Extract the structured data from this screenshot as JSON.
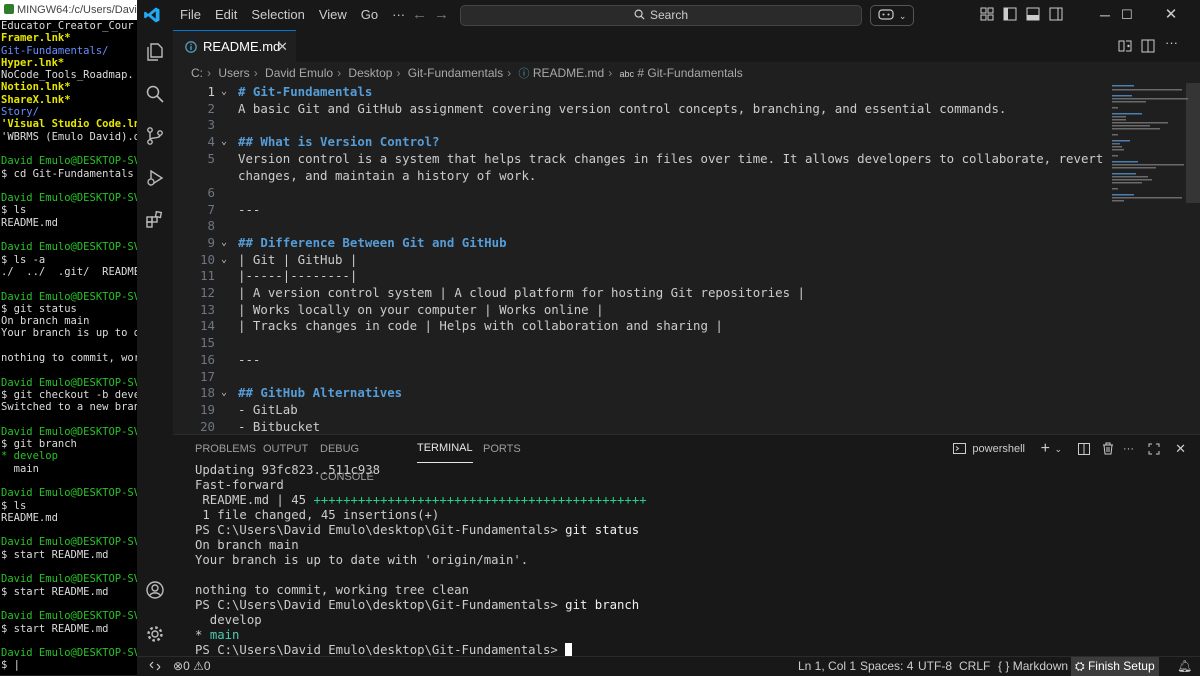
{
  "mingw": {
    "title": "MINGW64:/c/Users/David",
    "lines": [
      {
        "t": "Educator_Creator_Cour",
        "c": "w"
      },
      {
        "t": "Framer.lnk*",
        "c": "c"
      },
      {
        "t": "Git-Fundamentals/",
        "c": "b"
      },
      {
        "t": "Hyper.lnk*",
        "c": "c"
      },
      {
        "t": "NoCode_Tools_Roadmap.",
        "c": "w"
      },
      {
        "t": "Notion.lnk*",
        "c": "c"
      },
      {
        "t": "ShareX.lnk*",
        "c": "c"
      },
      {
        "t": "Story/",
        "c": "b"
      },
      {
        "t": "'Visual Studio Code.ln",
        "c": "c"
      },
      {
        "t": "'WBRMS (Emulo David).d",
        "c": "w"
      },
      {
        "t": "",
        "c": "w"
      },
      {
        "t": "David Emulo@DESKTOP-SV",
        "c": "g"
      },
      {
        "t": "$ cd Git-Fundamentals",
        "c": "w"
      },
      {
        "t": "",
        "c": "w"
      },
      {
        "t": "David Emulo@DESKTOP-SV",
        "c": "g"
      },
      {
        "t": "$ ls",
        "c": "w"
      },
      {
        "t": "README.md",
        "c": "w"
      },
      {
        "t": "",
        "c": "w"
      },
      {
        "t": "David Emulo@DESKTOP-SV",
        "c": "g"
      },
      {
        "t": "$ ls -a",
        "c": "w"
      },
      {
        "t": "./  ../  .git/  README",
        "c": "w"
      },
      {
        "t": "",
        "c": "w"
      },
      {
        "t": "David Emulo@DESKTOP-SV",
        "c": "g"
      },
      {
        "t": "$ git status",
        "c": "w"
      },
      {
        "t": "On branch main",
        "c": "w"
      },
      {
        "t": "Your branch is up to d",
        "c": "w"
      },
      {
        "t": "",
        "c": "w"
      },
      {
        "t": "nothing to commit, wor",
        "c": "w"
      },
      {
        "t": "",
        "c": "w"
      },
      {
        "t": "David Emulo@DESKTOP-SV",
        "c": "g"
      },
      {
        "t": "$ git checkout -b deve",
        "c": "w"
      },
      {
        "t": "Switched to a new bran",
        "c": "w"
      },
      {
        "t": "",
        "c": "w"
      },
      {
        "t": "David Emulo@DESKTOP-SV",
        "c": "g"
      },
      {
        "t": "$ git branch",
        "c": "w"
      },
      {
        "t": "* develop",
        "c": "g"
      },
      {
        "t": "  main",
        "c": "w"
      },
      {
        "t": "",
        "c": "w"
      },
      {
        "t": "David Emulo@DESKTOP-SV",
        "c": "g"
      },
      {
        "t": "$ ls",
        "c": "w"
      },
      {
        "t": "README.md",
        "c": "w"
      },
      {
        "t": "",
        "c": "w"
      },
      {
        "t": "David Emulo@DESKTOP-SV",
        "c": "g"
      },
      {
        "t": "$ start README.md",
        "c": "w"
      },
      {
        "t": "",
        "c": "w"
      },
      {
        "t": "David Emulo@DESKTOP-SV",
        "c": "g"
      },
      {
        "t": "$ start README.md",
        "c": "w"
      },
      {
        "t": "",
        "c": "w"
      },
      {
        "t": "David Emulo@DESKTOP-SV",
        "c": "g"
      },
      {
        "t": "$ start README.md",
        "c": "w"
      },
      {
        "t": "",
        "c": "w"
      },
      {
        "t": "David Emulo@DESKTOP-SV",
        "c": "g"
      },
      {
        "t": "$ |",
        "c": "w"
      }
    ]
  },
  "titlebar": {
    "menu": [
      "File",
      "Edit",
      "Selection",
      "View",
      "Go",
      "···"
    ],
    "search_placeholder": "Search",
    "icons": [
      "copilot-icon",
      "layout-icon",
      "sidebar-toggle-icon",
      "panel-toggle-icon",
      "secondary-sidebar-icon"
    ]
  },
  "tab": {
    "filename": "README.md"
  },
  "breadcrumb": [
    "C:",
    "Users",
    "David Emulo",
    "Desktop",
    "Git-Fundamentals",
    "README.md",
    "# Git-Fundamentals"
  ],
  "editor": {
    "lines": [
      {
        "n": "1",
        "fold": "v",
        "t": "# Git-Fundamentals",
        "h": true,
        "cur": true
      },
      {
        "n": "2",
        "fold": "",
        "t": "A basic Git and GitHub assignment covering version control concepts, branching, and essential commands.",
        "h": false
      },
      {
        "n": "3",
        "fold": "",
        "t": "",
        "h": false
      },
      {
        "n": "4",
        "fold": "v",
        "t": "## What is Version Control?",
        "h": true
      },
      {
        "n": "5",
        "fold": "",
        "t": "Version control is a system that helps track changes in files over time. It allows developers to collaborate, revert\nchanges, and maintain a history of work.",
        "h": false,
        "wrap": true
      },
      {
        "n": "6",
        "fold": "",
        "t": "",
        "h": false
      },
      {
        "n": "7",
        "fold": "",
        "t": "---",
        "h": false
      },
      {
        "n": "8",
        "fold": "",
        "t": "",
        "h": false
      },
      {
        "n": "9",
        "fold": "v",
        "t": "## Difference Between Git and GitHub",
        "h": true
      },
      {
        "n": "10",
        "fold": "v",
        "t": "| Git | GitHub |",
        "h": false
      },
      {
        "n": "11",
        "fold": "",
        "t": "|-----|--------|",
        "h": false
      },
      {
        "n": "12",
        "fold": "",
        "t": "| A version control system | A cloud platform for hosting Git repositories |",
        "h": false
      },
      {
        "n": "13",
        "fold": "",
        "t": "| Works locally on your computer | Works online |",
        "h": false
      },
      {
        "n": "14",
        "fold": "",
        "t": "| Tracks changes in code | Helps with collaboration and sharing |",
        "h": false
      },
      {
        "n": "15",
        "fold": "",
        "t": "",
        "h": false
      },
      {
        "n": "16",
        "fold": "",
        "t": "---",
        "h": false
      },
      {
        "n": "17",
        "fold": "",
        "t": "",
        "h": false
      },
      {
        "n": "18",
        "fold": "v",
        "t": "## GitHub Alternatives",
        "h": true
      },
      {
        "n": "19",
        "fold": "",
        "t": "- GitLab",
        "h": false
      },
      {
        "n": "20",
        "fold": "",
        "t": "- Bitbucket",
        "h": false
      }
    ]
  },
  "panel": {
    "tabs": [
      "PROBLEMS",
      "OUTPUT",
      "DEBUG CONSOLE",
      "TERMINAL",
      "PORTS"
    ],
    "active_tab": "TERMINAL",
    "shell": "powershell",
    "terminal": [
      {
        "parts": [
          {
            "t": "Updating 93fc823..511c938",
            "c": "n"
          }
        ]
      },
      {
        "parts": [
          {
            "t": "Fast-forward",
            "c": "n"
          }
        ]
      },
      {
        "parts": [
          {
            "t": " README.md | 45 ",
            "c": "n"
          },
          {
            "t": "+++++++++++++++++++++++++++++++++++++++++++++",
            "c": "green"
          }
        ]
      },
      {
        "parts": [
          {
            "t": " 1 file changed, 45 insertions(+)",
            "c": "n"
          }
        ]
      },
      {
        "parts": [
          {
            "t": "PS C:\\Users\\David Emulo\\desktop\\Git-Fundamentals> ",
            "c": "n"
          },
          {
            "t": "git status",
            "c": "white"
          }
        ]
      },
      {
        "parts": [
          {
            "t": "On branch main",
            "c": "n"
          }
        ]
      },
      {
        "parts": [
          {
            "t": "Your branch is up to date with 'origin/main'.",
            "c": "n"
          }
        ]
      },
      {
        "parts": [
          {
            "t": "",
            "c": "n"
          }
        ]
      },
      {
        "parts": [
          {
            "t": "nothing to commit, working tree clean",
            "c": "n"
          }
        ]
      },
      {
        "parts": [
          {
            "t": "PS C:\\Users\\David Emulo\\desktop\\Git-Fundamentals> ",
            "c": "n"
          },
          {
            "t": "git branch",
            "c": "white"
          }
        ]
      },
      {
        "parts": [
          {
            "t": "  develop",
            "c": "n"
          }
        ]
      },
      {
        "parts": [
          {
            "t": "* ",
            "c": "n"
          },
          {
            "t": "main",
            "c": "cyan"
          }
        ]
      },
      {
        "parts": [
          {
            "t": "PS C:\\Users\\David Emulo\\desktop\\Git-Fundamentals> ",
            "c": "n"
          }
        ],
        "cursor": true
      }
    ]
  },
  "statusbar": {
    "errors": "0",
    "warnings": "0",
    "position": "Ln 1, Col 1",
    "spaces": "Spaces: 4",
    "encoding": "UTF-8",
    "eol": "CRLF",
    "language": "Markdown",
    "finish_setup": "Finish Setup"
  },
  "colors": {
    "accent": "#0078d4",
    "heading": "#569cd6",
    "terminal_green": "#23d18b"
  }
}
